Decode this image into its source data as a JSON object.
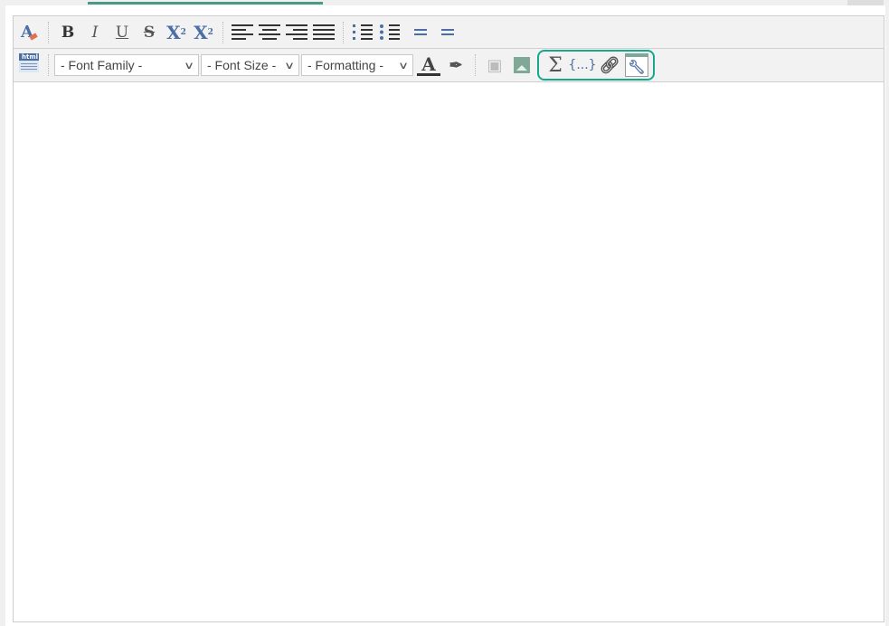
{
  "toolbar": {
    "font_family": "- Font Family -",
    "font_size": "- Font Size -",
    "formatting": "- Formatting -",
    "html_badge": "html",
    "bold": "B",
    "italic": "I",
    "underline": "U",
    "strike": "S",
    "subscript": "X",
    "subscript_mark": "2",
    "superscript": "X",
    "superscript_mark": "2",
    "text_color": "A",
    "sigma": "Σ",
    "placeholder": "{...}"
  },
  "colors": {
    "highlight": "#14a88c",
    "icon_blue": "#4a6fa5",
    "tab_accent": "#4a9a8a"
  }
}
